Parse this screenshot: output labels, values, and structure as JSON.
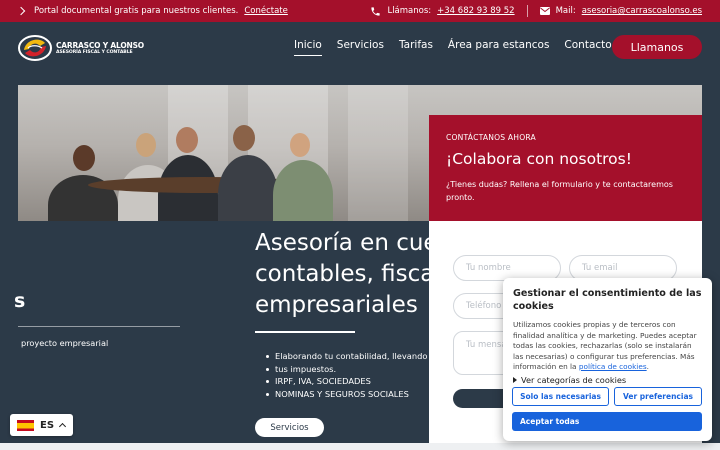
{
  "colors": {
    "brand_red": "#a4102b",
    "navy": "#2c3a48",
    "cookie_blue": "#1863dc"
  },
  "topbar": {
    "portal_text": "Portal documental gratis para nuestros clientes.",
    "portal_link": "Conéctate",
    "phone_label": "Llámanos:",
    "phone_number": "+34 682 93 89 52",
    "mail_label": "Mail:",
    "mail_address": "asesoria@carrascoalonso.es"
  },
  "logo": {
    "line1": "CARRASCO Y ALONSO",
    "line2": "ASESORÍA FISCAL Y CONTABLE"
  },
  "nav": {
    "items": [
      "Inicio",
      "Servicios",
      "Tarifas",
      "Área para estancos",
      "Contacto"
    ],
    "active": "Inicio"
  },
  "call_button": "Llamanos",
  "contact": {
    "kicker": "CONTÁCTANOS AHORA",
    "title": "¡Colabora con nosotros!",
    "description": "¿Tienes dudas? Rellena el formulario y te contactaremos pronto."
  },
  "form": {
    "name_placeholder": "Tu nombre",
    "email_placeholder": "Tu email",
    "phone_placeholder": "Teléfono",
    "message_placeholder": "Tu mensaje"
  },
  "hero": {
    "title_lines": [
      "Asesoría en cuentas",
      "contables, fiscales y",
      "empresariales"
    ],
    "list": [
      "Elaborando tu contabilidad, llevando tus",
      "tus impuestos.",
      "IRPF, IVA, SOCIEDADES",
      "NOMINAS Y SEGUROS SOCIALES"
    ],
    "button": "Servicios"
  },
  "left_panel": {
    "letter": "s",
    "text": "proyecto empresarial"
  },
  "language": {
    "code": "ES"
  },
  "cookie": {
    "title": "Gestionar el consentimiento de las cookies",
    "body_text": "Utilizamos cookies propias y de terceros con finalidad analítica y de marketing. Puedes aceptar todas las cookies, rechazarlas (solo se instalarán las necesarias) o configurar tus preferencias. Más información en la",
    "policy_link": "política de cookies",
    "categories_label": "Ver categorías de cookies",
    "btn_necessary": "Solo las necesarias",
    "btn_preferences": "Ver preferencias",
    "btn_accept": "Aceptar todas"
  }
}
